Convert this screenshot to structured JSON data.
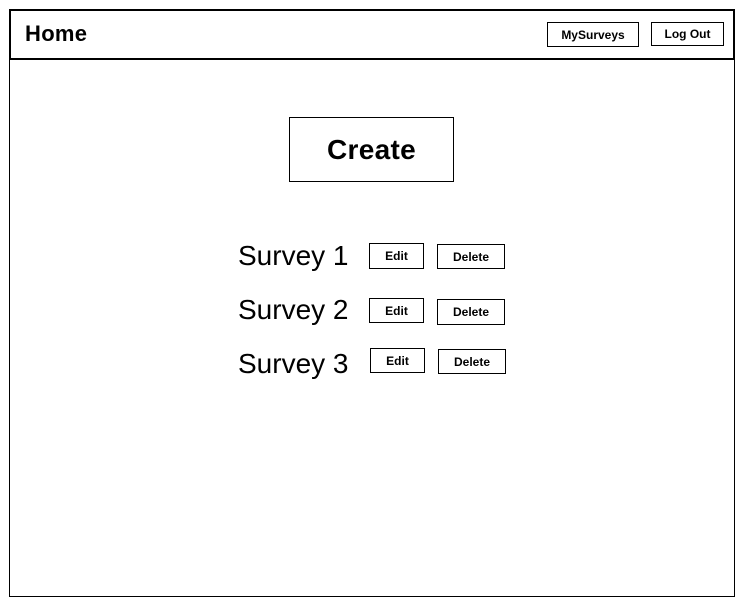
{
  "header": {
    "title": "Home",
    "my_surveys_label": "MySurveys",
    "logout_label": "Log Out"
  },
  "main": {
    "create_label": "Create",
    "surveys": [
      {
        "name": "Survey 1",
        "edit_label": "Edit",
        "delete_label": "Delete"
      },
      {
        "name": "Survey 2",
        "edit_label": "Edit",
        "delete_label": "Delete"
      },
      {
        "name": "Survey 3",
        "edit_label": "Edit",
        "delete_label": "Delete"
      }
    ]
  }
}
